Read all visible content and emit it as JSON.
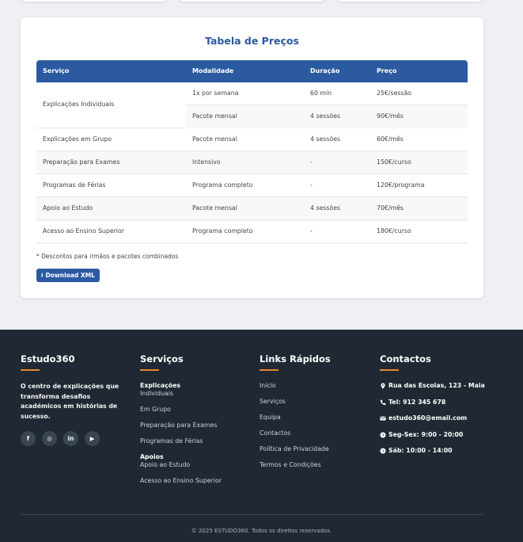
{
  "pricing": {
    "title": "Tabela de Preços",
    "headers": [
      "Serviço",
      "Modalidade",
      "Duração",
      "Preço"
    ],
    "grouped_row": {
      "service": "Explicações Individuais",
      "options": [
        {
          "mode": "1x por semana",
          "duration": "60 min",
          "price": "25€/sessão"
        },
        {
          "mode": "Pacote mensal",
          "duration": "4 sessões",
          "price": "90€/mês"
        }
      ]
    },
    "rows": [
      {
        "service": "Explicações em Grupo",
        "mode": "Pacote mensal",
        "duration": "4 sessões",
        "price": "60€/mês"
      },
      {
        "service": "Preparação para Exames",
        "mode": "Intensivo",
        "duration": "-",
        "price": "150€/curso"
      },
      {
        "service": "Programas de Férias",
        "mode": "Programa completo",
        "duration": "-",
        "price": "120€/programa"
      },
      {
        "service": "Apoio ao Estudo",
        "mode": "Pacote mensal",
        "duration": "4 sessões",
        "price": "70€/mês"
      },
      {
        "service": "Acesso ao Ensino Superior",
        "mode": "Programa completo",
        "duration": "-",
        "price": "180€/curso"
      }
    ],
    "note": "* Descontos para irmãos e pacotes combinados",
    "download_label": "Download XML"
  },
  "footer": {
    "brand": "Estudo360",
    "about": "O centro de explicações que transforma desafios académicos em histórias de sucesso.",
    "social": [
      {
        "icon": "facebook-icon",
        "glyph": "f"
      },
      {
        "icon": "instagram-icon",
        "glyph": "◎"
      },
      {
        "icon": "linkedin-icon",
        "glyph": "in"
      },
      {
        "icon": "youtube-icon",
        "glyph": "▶"
      }
    ],
    "services_title": "Serviços",
    "services": [
      {
        "bold": "Explicações",
        "rest": "Individuais"
      },
      {
        "bold": "",
        "rest": "Em Grupo"
      },
      {
        "bold": "",
        "rest": "Preparação para Exames"
      },
      {
        "bold": "",
        "rest": "Programas de Férias"
      },
      {
        "bold": "Apoios",
        "rest": "Apoio ao Estudo"
      },
      {
        "bold": "",
        "rest": "Acesso ao Ensino Superior"
      }
    ],
    "links_title": "Links Rápidos",
    "links": [
      "Início",
      "Serviços",
      "Equipa",
      "Contactos",
      "Política de Privacidade",
      "Termos e Condições"
    ],
    "contacts_title": "Contactos",
    "contacts": [
      {
        "icon": "map-pin-icon",
        "text": "Rua das Escolas, 123 - Maia"
      },
      {
        "icon": "phone-icon",
        "text": "Tel: 912 345 678"
      },
      {
        "icon": "email-icon",
        "text": "estudo360@email.com"
      },
      {
        "icon": "clock-icon",
        "text": "Seg-Sex: 9:00 - 20:00"
      },
      {
        "icon": "clock-icon",
        "text": "Sáb: 10:00 - 14:00"
      }
    ],
    "copyright": "© 2025 ESTUDO360. Todos os direitos reservados."
  },
  "colors": {
    "primary": "#2c5aa0",
    "footer_bg": "#1f2833",
    "accent": "#e8862d"
  }
}
